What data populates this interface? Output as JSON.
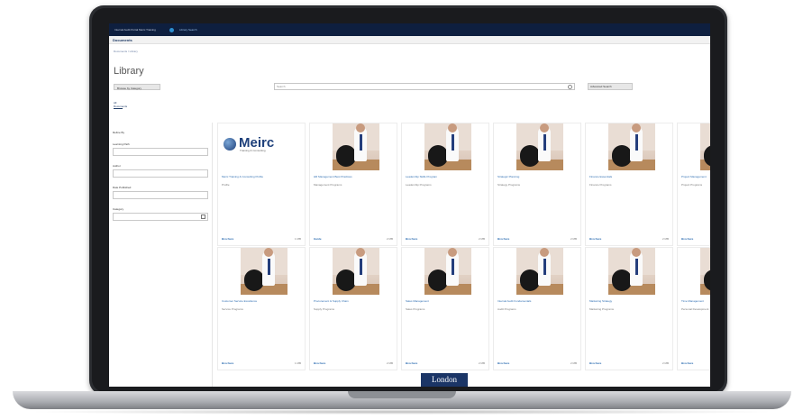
{
  "header": {
    "org_name": "Internal Audit Portal Meirc Training",
    "link": "Library Search",
    "section": "Documents"
  },
  "breadcrumb": "Documents / Library",
  "page_title": "Library",
  "toolbar": {
    "browse_label": "Browse by Category",
    "search_placeholder": "Search",
    "advanced_label": "Advanced Search"
  },
  "tabs": [
    {
      "label": "All Documents"
    }
  ],
  "sidebar": {
    "filters_label": "Refine By",
    "fields": [
      {
        "label": "Learning Path"
      },
      {
        "label": "Author"
      },
      {
        "label": "Date Published"
      },
      {
        "label": "Category"
      }
    ]
  },
  "brand": {
    "name": "Meirc",
    "tagline": "Training & Consulting"
  },
  "cards": [
    {
      "title": "Meirc Training & Consulting Profile",
      "meta": "Profile",
      "foot": "Brochure",
      "size": "1 MB"
    },
    {
      "title": "HR Management Best Practices",
      "meta": "Management Programs",
      "foot": "Guide",
      "size": "2 MB"
    },
    {
      "title": "Leadership Skills Program",
      "meta": "Leadership Programs",
      "foot": "Brochure",
      "size": "2 MB"
    },
    {
      "title": "Strategic Planning",
      "meta": "Strategy Programs",
      "foot": "Brochure",
      "size": "2 MB"
    },
    {
      "title": "Finance Essentials",
      "meta": "Finance Programs",
      "foot": "Brochure",
      "size": "2 MB"
    },
    {
      "title": "Project Management",
      "meta": "Project Programs",
      "foot": "Brochure",
      "size": "2 MB"
    },
    {
      "title": "Customer Service Excellence",
      "meta": "Service Programs",
      "foot": "Brochure",
      "size": "1 MB"
    },
    {
      "title": "Procurement & Supply Chain",
      "meta": "Supply Programs",
      "foot": "Brochure",
      "size": "2 MB"
    },
    {
      "title": "Sales Management",
      "meta": "Sales Programs",
      "foot": "Brochure",
      "size": "2 MB"
    },
    {
      "title": "Internal Audit Fundamentals",
      "meta": "Audit Programs",
      "foot": "Brochure",
      "size": "2 MB"
    },
    {
      "title": "Marketing Strategy",
      "meta": "Marketing Programs",
      "foot": "Brochure",
      "size": "2 MB"
    },
    {
      "title": "Time Management",
      "meta": "Personal Development",
      "foot": "Brochure",
      "size": "1 MB"
    }
  ],
  "bottom_banner": "London"
}
